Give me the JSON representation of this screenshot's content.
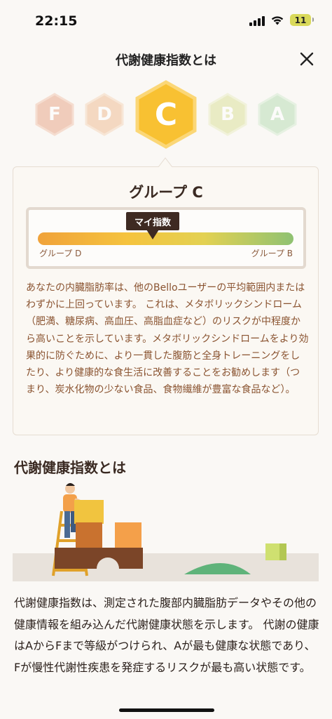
{
  "status_bar": {
    "time": "22:15",
    "battery_level": "11",
    "signal_bars": 4,
    "icons": [
      "signal-icon",
      "wifi-icon",
      "battery-icon"
    ]
  },
  "header": {
    "title": "代謝健康指数とは",
    "close_icon": "close-icon"
  },
  "grades": {
    "items": [
      {
        "letter": "F",
        "color": "#e8a283",
        "selected": false
      },
      {
        "letter": "D",
        "color": "#efb98f",
        "selected": false
      },
      {
        "letter": "C",
        "color": "#f8c132",
        "selected": true
      },
      {
        "letter": "B",
        "color": "#d9df95",
        "selected": false
      },
      {
        "letter": "A",
        "color": "#b4dcb0",
        "selected": false
      }
    ]
  },
  "result_card": {
    "group_title": "グループ C",
    "my_index_label": "マイ指数",
    "my_index_position_fraction": 0.45,
    "scale_left_label": "グループ D",
    "scale_right_label": "グループ B",
    "description": "あなたの内臓脂肪率は、他のBelloユーザーの平均範囲内またはわずかに上回っています。 これは、メタボリックシンドローム（肥満、糖尿病、高血圧、高脂血症など）のリスクが中程度から高いことを示しています。メタボリックシンドロームをより効果的に防ぐために、より一貫した腹筋と全身トレーニングをしたり、より健康的な食生活に改善することをお勧めします（つまり、炭水化物の少ない食品、食物繊維が豊富な食品など）。"
  },
  "about_section": {
    "heading": "代謝健康指数とは",
    "body": "代謝健康指数は、測定された腹部内臓脂肪データやその他の健康情報を組み込んだ代謝健康状態を示します。 代謝の健康はAからFまで等級がつけられ、Aが最も健康な状態であり、Fが慢性代謝性疾患を発症するリスクが最も高い状態です。"
  },
  "colors": {
    "accent_yellow": "#f8c132",
    "text_brown": "#8a5330",
    "dark_brown": "#3e2a22",
    "background": "#faf8f5"
  }
}
